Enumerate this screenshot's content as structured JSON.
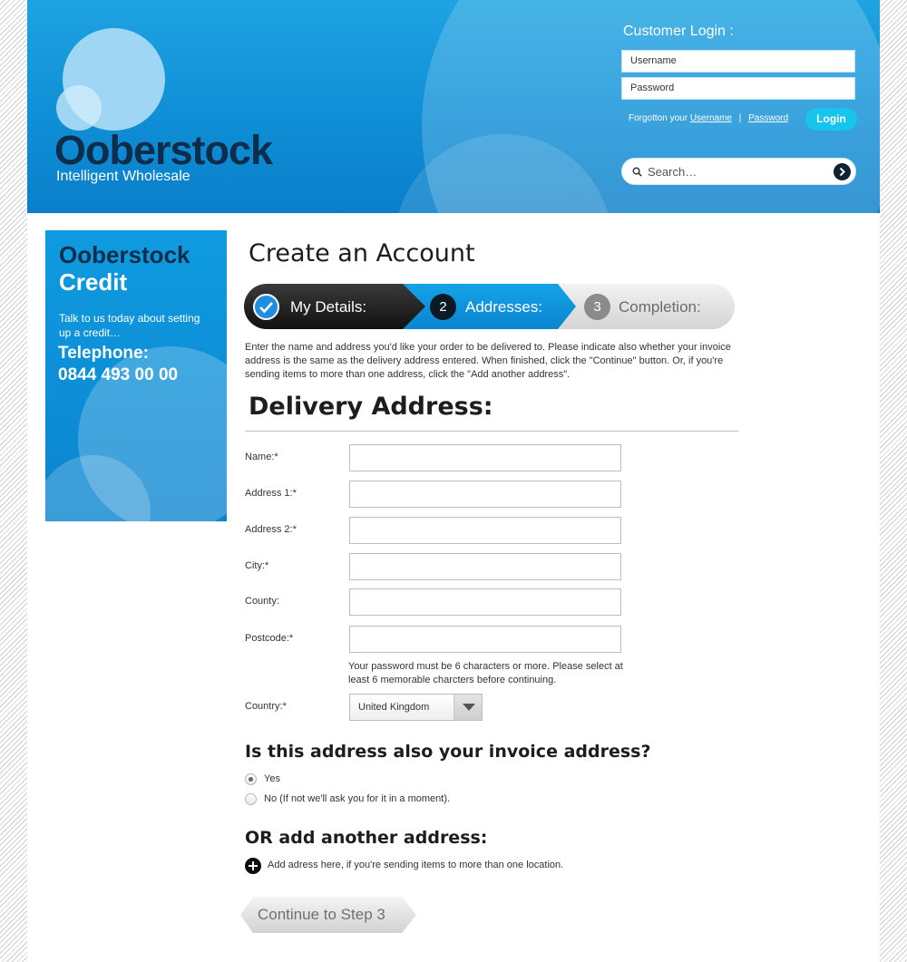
{
  "brand": {
    "name": "Ooberstock",
    "tagline": "Intelligent Wholesale"
  },
  "login": {
    "title": "Customer Login :",
    "username_placeholder": "Username",
    "password_placeholder": "Password",
    "forgot_prefix": "Forgotton your",
    "forgot_username": "Username",
    "forgot_separator": "|",
    "forgot_password": "Password",
    "button": "Login"
  },
  "search": {
    "placeholder": "Search…"
  },
  "promo": {
    "title_line1": "Ooberstock",
    "title_line2": "Credit",
    "text": "Talk to us today about setting up a credit…",
    "tel_label": "Telephone:",
    "tel_number": "0844 493 00 00"
  },
  "page": {
    "title": "Create an Account",
    "steps": [
      {
        "number": "✓",
        "label": "My Details:"
      },
      {
        "number": "2",
        "label": "Addresses:"
      },
      {
        "number": "3",
        "label": "Completion:"
      }
    ],
    "intro": "Enter the name and address you'd like your order to be delivered to. Please indicate also whether your invoice address is the same as the delivery address entered. When finished, click the \"Continue\" button. Or, if you're sending items to more than one address, click the \"Add another address\".",
    "section_title": "Delivery Address:"
  },
  "form": {
    "name_label": "Name:*",
    "address1_label": "Address 1:*",
    "address2_label": "Address 2:*",
    "city_label": "City:*",
    "county_label": "County:",
    "postcode_label": "Postcode:*",
    "hint": "Your password must be 6 characters or more. Please select at least 6 memorable charcters before continuing.",
    "country_label": "Country:*",
    "country_value": "United Kingdom"
  },
  "invoice": {
    "question": "Is this address also your invoice address?",
    "yes_label": "Yes",
    "no_label": "No  (If not we'll ask you for it in a moment).",
    "selected": "Yes"
  },
  "another": {
    "title": "OR add another address:",
    "add_text": "Add adress here, if you're sending items to more than one location."
  },
  "actions": {
    "continue_label": "Continue to Step 3"
  },
  "colors": {
    "brand_blue": "#0f8fd6",
    "brand_dark": "#0d2d4a",
    "login_button": "#17c4ec",
    "step_active": "#0a85d0"
  },
  "icons": {
    "search": "search-icon",
    "search_go": "arrow-right-icon",
    "step_done": "checkmark-icon",
    "add": "plus-circle-icon",
    "select_arrow": "chevron-down-icon"
  }
}
